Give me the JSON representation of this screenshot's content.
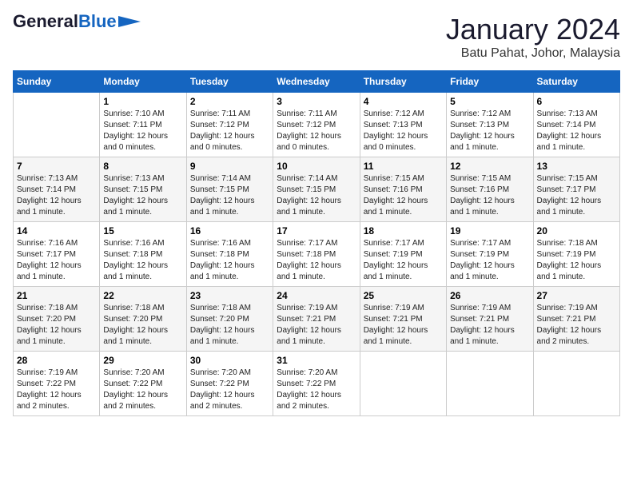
{
  "logo": {
    "part1": "General",
    "part2": "Blue"
  },
  "title": "January 2024",
  "subtitle": "Batu Pahat, Johor, Malaysia",
  "days_of_week": [
    "Sunday",
    "Monday",
    "Tuesday",
    "Wednesday",
    "Thursday",
    "Friday",
    "Saturday"
  ],
  "weeks": [
    [
      {
        "day": "",
        "info": ""
      },
      {
        "day": "1",
        "info": "Sunrise: 7:10 AM\nSunset: 7:11 PM\nDaylight: 12 hours and 0 minutes."
      },
      {
        "day": "2",
        "info": "Sunrise: 7:11 AM\nSunset: 7:12 PM\nDaylight: 12 hours and 0 minutes."
      },
      {
        "day": "3",
        "info": "Sunrise: 7:11 AM\nSunset: 7:12 PM\nDaylight: 12 hours and 0 minutes."
      },
      {
        "day": "4",
        "info": "Sunrise: 7:12 AM\nSunset: 7:13 PM\nDaylight: 12 hours and 0 minutes."
      },
      {
        "day": "5",
        "info": "Sunrise: 7:12 AM\nSunset: 7:13 PM\nDaylight: 12 hours and 1 minute."
      },
      {
        "day": "6",
        "info": "Sunrise: 7:13 AM\nSunset: 7:14 PM\nDaylight: 12 hours and 1 minute."
      }
    ],
    [
      {
        "day": "7",
        "info": "Sunrise: 7:13 AM\nSunset: 7:14 PM\nDaylight: 12 hours and 1 minute."
      },
      {
        "day": "8",
        "info": "Sunrise: 7:13 AM\nSunset: 7:15 PM\nDaylight: 12 hours and 1 minute."
      },
      {
        "day": "9",
        "info": "Sunrise: 7:14 AM\nSunset: 7:15 PM\nDaylight: 12 hours and 1 minute."
      },
      {
        "day": "10",
        "info": "Sunrise: 7:14 AM\nSunset: 7:15 PM\nDaylight: 12 hours and 1 minute."
      },
      {
        "day": "11",
        "info": "Sunrise: 7:15 AM\nSunset: 7:16 PM\nDaylight: 12 hours and 1 minute."
      },
      {
        "day": "12",
        "info": "Sunrise: 7:15 AM\nSunset: 7:16 PM\nDaylight: 12 hours and 1 minute."
      },
      {
        "day": "13",
        "info": "Sunrise: 7:15 AM\nSunset: 7:17 PM\nDaylight: 12 hours and 1 minute."
      }
    ],
    [
      {
        "day": "14",
        "info": "Sunrise: 7:16 AM\nSunset: 7:17 PM\nDaylight: 12 hours and 1 minute."
      },
      {
        "day": "15",
        "info": "Sunrise: 7:16 AM\nSunset: 7:18 PM\nDaylight: 12 hours and 1 minute."
      },
      {
        "day": "16",
        "info": "Sunrise: 7:16 AM\nSunset: 7:18 PM\nDaylight: 12 hours and 1 minute."
      },
      {
        "day": "17",
        "info": "Sunrise: 7:17 AM\nSunset: 7:18 PM\nDaylight: 12 hours and 1 minute."
      },
      {
        "day": "18",
        "info": "Sunrise: 7:17 AM\nSunset: 7:19 PM\nDaylight: 12 hours and 1 minute."
      },
      {
        "day": "19",
        "info": "Sunrise: 7:17 AM\nSunset: 7:19 PM\nDaylight: 12 hours and 1 minute."
      },
      {
        "day": "20",
        "info": "Sunrise: 7:18 AM\nSunset: 7:19 PM\nDaylight: 12 hours and 1 minute."
      }
    ],
    [
      {
        "day": "21",
        "info": "Sunrise: 7:18 AM\nSunset: 7:20 PM\nDaylight: 12 hours and 1 minute."
      },
      {
        "day": "22",
        "info": "Sunrise: 7:18 AM\nSunset: 7:20 PM\nDaylight: 12 hours and 1 minute."
      },
      {
        "day": "23",
        "info": "Sunrise: 7:18 AM\nSunset: 7:20 PM\nDaylight: 12 hours and 1 minute."
      },
      {
        "day": "24",
        "info": "Sunrise: 7:19 AM\nSunset: 7:21 PM\nDaylight: 12 hours and 1 minute."
      },
      {
        "day": "25",
        "info": "Sunrise: 7:19 AM\nSunset: 7:21 PM\nDaylight: 12 hours and 1 minute."
      },
      {
        "day": "26",
        "info": "Sunrise: 7:19 AM\nSunset: 7:21 PM\nDaylight: 12 hours and 1 minute."
      },
      {
        "day": "27",
        "info": "Sunrise: 7:19 AM\nSunset: 7:21 PM\nDaylight: 12 hours and 2 minutes."
      }
    ],
    [
      {
        "day": "28",
        "info": "Sunrise: 7:19 AM\nSunset: 7:22 PM\nDaylight: 12 hours and 2 minutes."
      },
      {
        "day": "29",
        "info": "Sunrise: 7:20 AM\nSunset: 7:22 PM\nDaylight: 12 hours and 2 minutes."
      },
      {
        "day": "30",
        "info": "Sunrise: 7:20 AM\nSunset: 7:22 PM\nDaylight: 12 hours and 2 minutes."
      },
      {
        "day": "31",
        "info": "Sunrise: 7:20 AM\nSunset: 7:22 PM\nDaylight: 12 hours and 2 minutes."
      },
      {
        "day": "",
        "info": ""
      },
      {
        "day": "",
        "info": ""
      },
      {
        "day": "",
        "info": ""
      }
    ]
  ]
}
